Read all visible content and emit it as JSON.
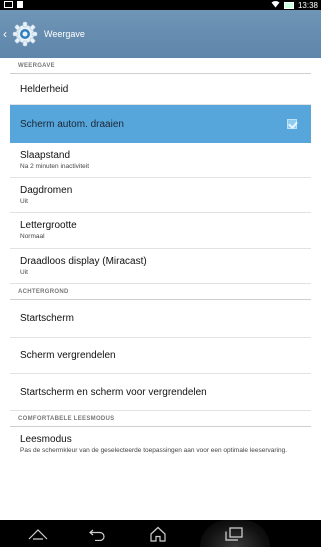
{
  "status": {
    "time": "13:38"
  },
  "header": {
    "title": "Weergave",
    "icon": "settings-gear-icon"
  },
  "sections": [
    {
      "label": "WEERGAVE"
    },
    {
      "label": "ACHTERGROND"
    },
    {
      "label": "COMFORTABELE LEESMODUS"
    }
  ],
  "items": {
    "helderheid": {
      "title": "Helderheid"
    },
    "rotate": {
      "title": "Scherm autom. draaien",
      "checked": true
    },
    "slaapstand": {
      "title": "Slaapstand",
      "summary": "Na 2 minuten inactiviteit"
    },
    "dagdromen": {
      "title": "Dagdromen",
      "summary": "Uit"
    },
    "lettergrootte": {
      "title": "Lettergrootte",
      "summary": "Normaal"
    },
    "miracast": {
      "title": "Draadloos display (Miracast)",
      "summary": "Uit"
    },
    "startscherm": {
      "title": "Startscherm"
    },
    "vergrendelen": {
      "title": "Scherm vergrendelen"
    },
    "beide": {
      "title": "Startscherm en scherm voor vergrendelen"
    },
    "leesmodus": {
      "title": "Leesmodus",
      "summary": "Pas de schermkleur van de geselecteerde toepassingen aan voor een optimale leeservaring."
    }
  },
  "colors": {
    "actionbar": "#6a90b2",
    "selected": "#56a6dc"
  }
}
